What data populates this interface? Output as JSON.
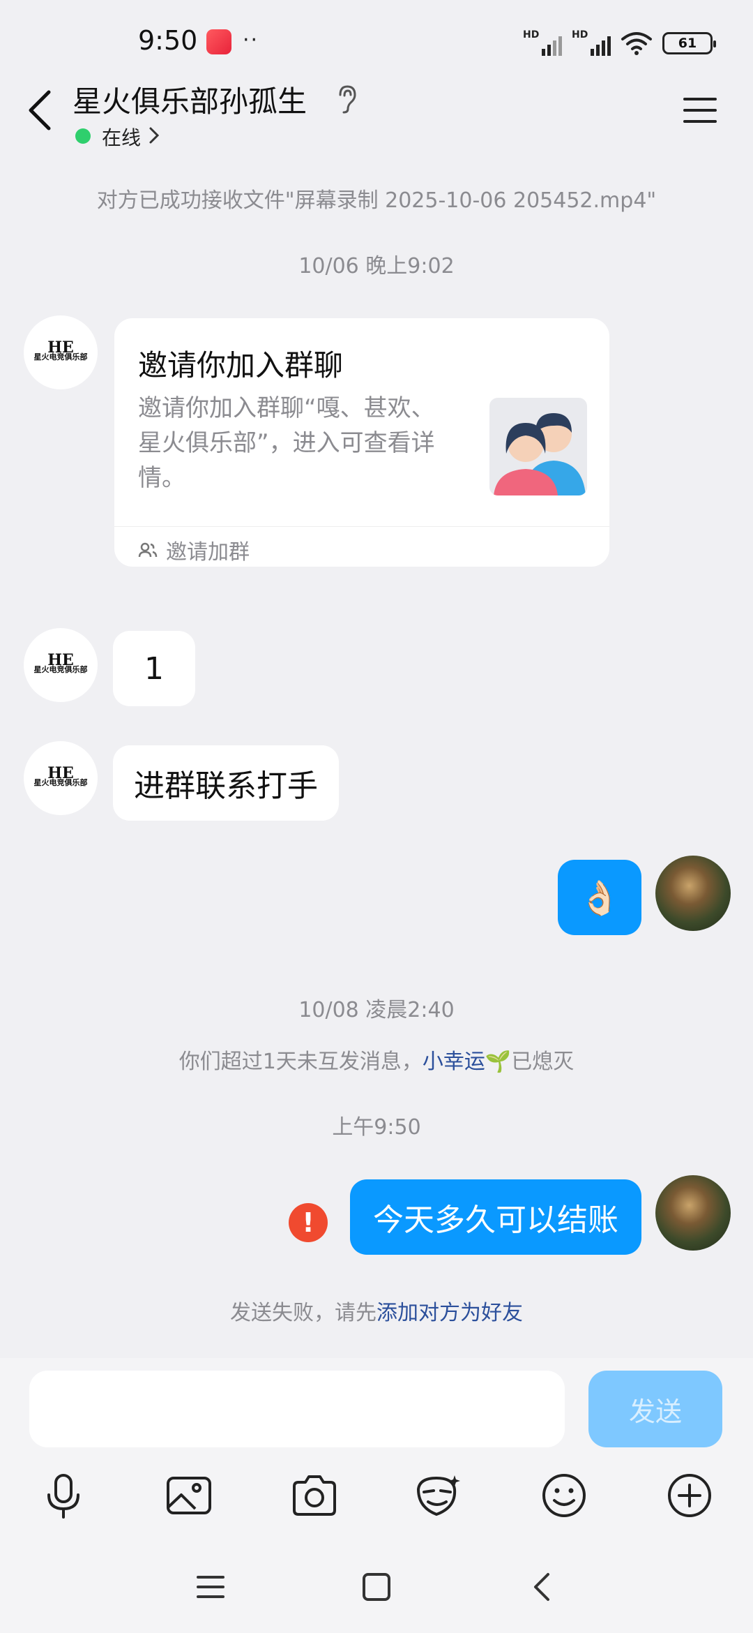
{
  "status_bar": {
    "time": "9:50",
    "dots": "··",
    "hd1": "HD",
    "hd2": "HD",
    "battery": "61"
  },
  "header": {
    "title": "星火俱乐部孙孤生",
    "status": "在线"
  },
  "messages": {
    "file_notice": "对方已成功接收文件\"屏幕录制 2025-10-06 205452.mp4\"",
    "time1": "10/06 晚上9:02",
    "invite_card": {
      "title": "邀请你加入群聊",
      "desc": "邀请你加入群聊“嘎、甚欢、星火俱乐部”，进入可查看详情。",
      "footer": "邀请加群"
    },
    "msg_1": "1",
    "msg_2": "进群联系打手",
    "msg_me_emoji": "👌🏻",
    "time2": "10/08 凌晨2:40",
    "streak_prefix": "你们超过1天未互发消息，",
    "streak_link": "小幸运",
    "streak_emoji": "🌱",
    "streak_suffix": "已熄灭",
    "time3": "上午9:50",
    "msg_me_2": "今天多久可以结账",
    "fail_prefix": "发送失败，请先",
    "fail_link": "添加对方为好友"
  },
  "avatar_logo": {
    "mark": "HE",
    "text": "星火电竞俱乐部"
  },
  "input": {
    "placeholder": "",
    "send_label": "发送"
  },
  "colors": {
    "accent": "#0a99ff",
    "online": "#2fcf6d",
    "error": "#f04a2f",
    "link": "#2b4f9b"
  },
  "toolbar_icons": [
    "microphone-icon",
    "image-icon",
    "camera-icon",
    "red-packet-icon",
    "emoji-icon",
    "plus-icon"
  ]
}
